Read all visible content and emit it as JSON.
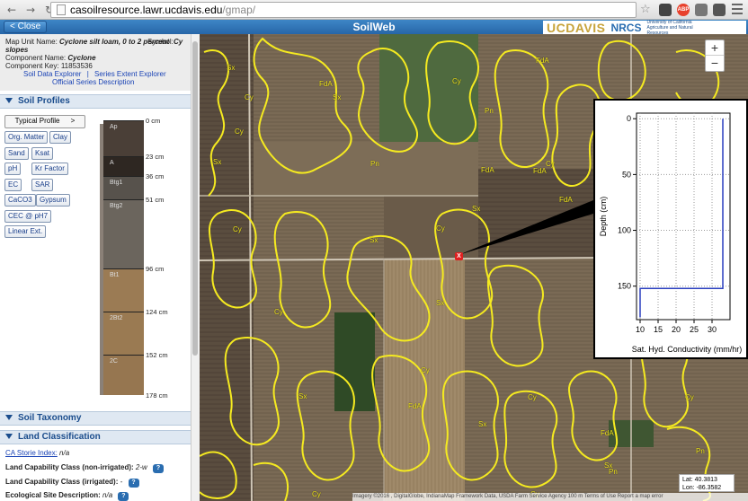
{
  "browser": {
    "url_host": "casoilresource.lawr.ucdavis.edu",
    "url_path": "/gmap/"
  },
  "header": {
    "close_label": "< Close",
    "title": "SoilWeb",
    "ucdavis": "UCDAVIS",
    "nrcs": "NRCS",
    "uc_text": "University of California Agriculture and Natural Resources"
  },
  "map_unit": {
    "name_label": "Map Unit Name:",
    "name_value": "Cyclone silt loam, 0 to 2 percent slopes",
    "symbol_label": "Symbol:",
    "symbol_value": "Cy",
    "component_label": "Component Name:",
    "component_value": "Cyclone",
    "key_label": "Component Key:",
    "key_value": "11853536",
    "link_sde": "Soil Data Explorer",
    "link_separator": "|",
    "link_see": "Series Extent Explorer",
    "link_osd": "Official Series Description"
  },
  "sections": {
    "soil_profiles": "Soil Profiles",
    "soil_taxonomy": "Soil Taxonomy",
    "land_classification": "Land Classification"
  },
  "profile_buttons": {
    "typical": "Typical Profile",
    "typical_arrow": ">",
    "org_matter": "Org. Matter",
    "clay": "Clay",
    "sand": "Sand",
    "ksat": "Ksat",
    "ph": "pH",
    "kr_factor": "Kr Factor",
    "ec": "EC",
    "sar": "SAR",
    "caco3": "CaCO3",
    "gypsum": "Gypsum",
    "cec": "CEC @ pH7",
    "linear_ext": "Linear Ext."
  },
  "horizons": [
    {
      "name": "Ap",
      "top": 0,
      "bottom": 23,
      "color": "#4a3f37"
    },
    {
      "name": "A",
      "top": 23,
      "bottom": 36,
      "color": "#2e2722"
    },
    {
      "name": "Btg1",
      "top": 36,
      "bottom": 51,
      "color": "#57524c"
    },
    {
      "name": "Btg2",
      "top": 51,
      "bottom": 96,
      "color": "#6b655d"
    },
    {
      "name": "Bt1",
      "top": 96,
      "bottom": 124,
      "color": "#9b7b54"
    },
    {
      "name": "2Bt2",
      "top": 124,
      "bottom": 152,
      "color": "#9a7a52"
    },
    {
      "name": "2C",
      "top": 152,
      "bottom": 178,
      "color": "#967650"
    }
  ],
  "depth_labels": [
    "0 cm",
    "23 cm",
    "36 cm",
    "51 cm",
    "96 cm",
    "124 cm",
    "152 cm",
    "178 cm"
  ],
  "land_class": {
    "storie_label": "CA Storie Index:",
    "storie_value": "n/a",
    "lcc_nonirr_label": "Land Capability Class (non-irrigated):",
    "lcc_nonirr_value": "2-w",
    "lcc_irr_label": "Land Capability Class (irrigated):",
    "lcc_irr_value": "-",
    "eco_label": "Ecological Site Description:",
    "eco_value": "n/a",
    "help": "?"
  },
  "map": {
    "zoom_in": "+",
    "zoom_out": "−",
    "marker": "X",
    "lat": "Lat: 40.3813",
    "lon": "Lon: -86.3582",
    "attribution": "Imagery ©2016 , DigitalGlobe, IndianaMap Framework Data, USDA Farm Service Agency   100 m        Terms of Use   Report a map error",
    "labels": [
      {
        "text": "Sx",
        "cls": "a"
      },
      {
        "text": "FdA",
        "cls": "b"
      },
      {
        "text": "Cy",
        "cls": "c"
      },
      {
        "text": "Sx",
        "cls": "d"
      },
      {
        "text": "Cy",
        "cls": "e"
      },
      {
        "text": "Pn",
        "cls": "f"
      },
      {
        "text": "FdA",
        "cls": "g"
      },
      {
        "text": "Pn",
        "cls": "h"
      },
      {
        "text": "FdA",
        "cls": "i"
      },
      {
        "text": "FdA",
        "cls": "j"
      },
      {
        "text": "Cy",
        "cls": "k"
      },
      {
        "text": "Sx",
        "cls": "l"
      },
      {
        "text": "Cy",
        "cls": "m"
      },
      {
        "text": "Sx",
        "cls": "n"
      },
      {
        "text": "Sx",
        "cls": "o"
      },
      {
        "text": "Cy",
        "cls": "p"
      },
      {
        "text": "Cy",
        "cls": "q"
      },
      {
        "text": "Cy",
        "cls": "r"
      },
      {
        "text": "Sx",
        "cls": "s"
      },
      {
        "text": "FdA",
        "cls": "t"
      },
      {
        "text": "Sx",
        "cls": "u"
      },
      {
        "text": "Cy",
        "cls": "v"
      },
      {
        "text": "FdA",
        "cls": "w"
      },
      {
        "text": "Sx",
        "cls": "x"
      },
      {
        "text": "Pn",
        "cls": "y"
      },
      {
        "text": "Cy",
        "cls": "z"
      },
      {
        "text": "Cy",
        "cls": "aa"
      },
      {
        "text": "Pn",
        "cls": "ab"
      },
      {
        "text": "Cy",
        "cls": "ac"
      },
      {
        "text": "Cy",
        "cls": "ad"
      },
      {
        "text": "FdA",
        "cls": "ae"
      },
      {
        "text": "Sx",
        "cls": "af"
      },
      {
        "text": "Cy",
        "cls": "ag"
      }
    ]
  },
  "chart_data": {
    "type": "line",
    "title": "",
    "xlabel": "Sat. Hyd. Conductivity (mm/hr)",
    "ylabel": "Depth (cm)",
    "xlim": [
      9,
      35
    ],
    "ylim": [
      180,
      -5
    ],
    "xticks": [
      10,
      15,
      20,
      25,
      30
    ],
    "yticks": [
      0,
      50,
      100,
      150
    ],
    "grid": true,
    "series": [
      {
        "x": [
          33,
          33,
          10,
          10
        ],
        "y": [
          0,
          152,
          152,
          178
        ],
        "color": "#2a3fbf"
      }
    ]
  }
}
